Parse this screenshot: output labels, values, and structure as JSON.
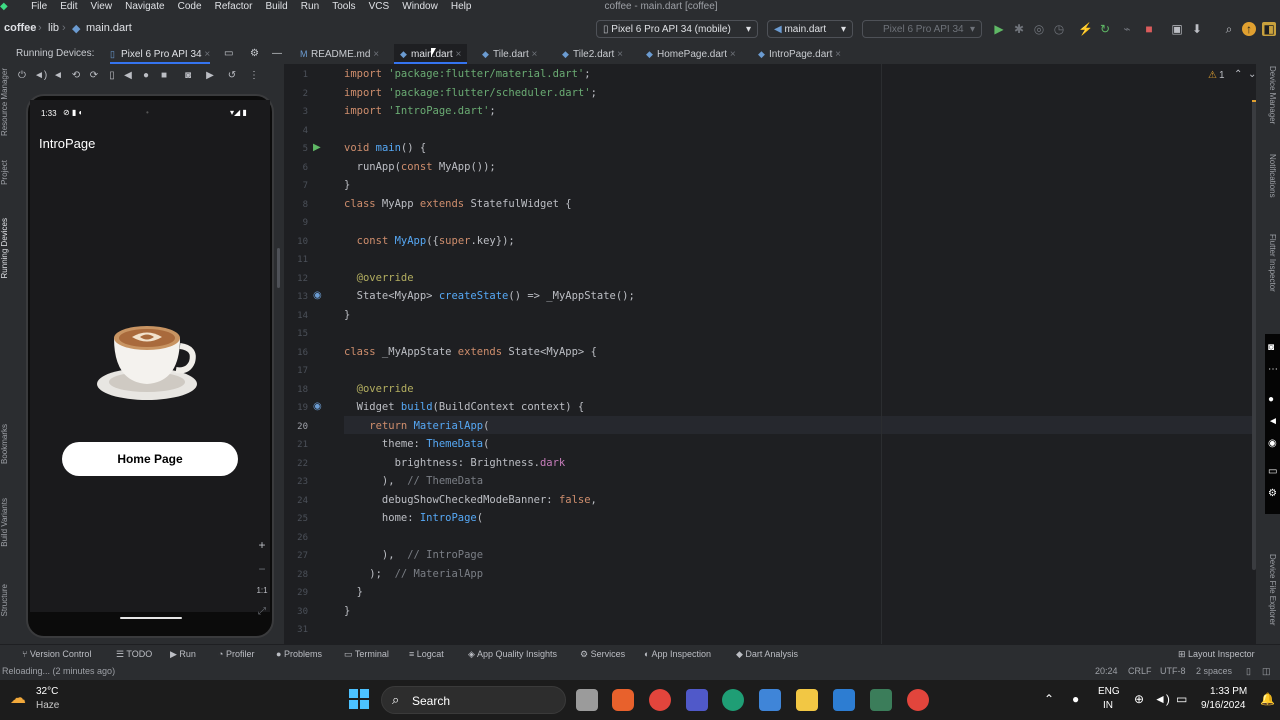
{
  "menu": [
    "File",
    "Edit",
    "View",
    "Navigate",
    "Code",
    "Refactor",
    "Build",
    "Run",
    "Tools",
    "VCS",
    "Window",
    "Help"
  ],
  "window_title": "coffee - main.dart [coffee]",
  "breadcrumb": {
    "project": "coffee",
    "folder": "lib",
    "file": "main.dart"
  },
  "device_selector": "Pixel 6 Pro API 34 (mobile)",
  "run_config": "main.dart",
  "device_selector_2": "Pixel 6 Pro API 34",
  "running_devices": {
    "label": "Running Devices:",
    "device_tab": "Pixel 6 Pro API 34"
  },
  "tabs": [
    {
      "label": "README.md",
      "active": false
    },
    {
      "label": "main.dart",
      "active": true
    },
    {
      "label": "Tile.dart",
      "active": false
    },
    {
      "label": "Tile2.dart",
      "active": false
    },
    {
      "label": "HomePage.dart",
      "active": false
    },
    {
      "label": "IntroPage.dart",
      "active": false
    }
  ],
  "inspection": {
    "warnings": "1"
  },
  "phone": {
    "time": "1:33",
    "app_title": "IntroPage",
    "home_button": "Home Page",
    "zoom_in": "+",
    "zoom_out": "−",
    "zoom_reset": "1:1"
  },
  "left_strip_labels": [
    "Resource Manager",
    "Project",
    "Running Devices",
    "Bookmarks",
    "Build Variants",
    "Structure"
  ],
  "right_strip_labels": [
    "Device Manager",
    "Notifications",
    "Flutter Inspector",
    "Device File Explorer"
  ],
  "code_lines": [
    {
      "n": "1",
      "t": [
        [
          "kw",
          "import"
        ],
        [
          "plain",
          " "
        ],
        [
          "str",
          "'package:flutter/material.dart'"
        ],
        [
          "plain",
          ";"
        ]
      ]
    },
    {
      "n": "2",
      "t": [
        [
          "kw",
          "import"
        ],
        [
          "plain",
          " "
        ],
        [
          "str",
          "'package:flutter/scheduler.dart'"
        ],
        [
          "plain",
          ";"
        ]
      ]
    },
    {
      "n": "3",
      "t": [
        [
          "kw",
          "import"
        ],
        [
          "plain",
          " "
        ],
        [
          "str",
          "'IntroPage.dart'"
        ],
        [
          "plain",
          ";"
        ]
      ]
    },
    {
      "n": "4",
      "t": []
    },
    {
      "n": "5",
      "t": [
        [
          "kw",
          "void"
        ],
        [
          "plain",
          " "
        ],
        [
          "fn",
          "main"
        ],
        [
          "plain",
          "() {"
        ]
      ]
    },
    {
      "n": "6",
      "t": [
        [
          "plain",
          "  runApp("
        ],
        [
          "kw",
          "const"
        ],
        [
          "plain",
          " MyApp());"
        ]
      ]
    },
    {
      "n": "7",
      "t": [
        [
          "plain",
          "}"
        ]
      ]
    },
    {
      "n": "8",
      "t": [
        [
          "kw",
          "class"
        ],
        [
          "plain",
          " MyApp "
        ],
        [
          "kw",
          "extends"
        ],
        [
          "plain",
          " StatefulWidget {"
        ]
      ]
    },
    {
      "n": "9",
      "t": []
    },
    {
      "n": "10",
      "t": [
        [
          "plain",
          "  "
        ],
        [
          "kw",
          "const"
        ],
        [
          "plain",
          " "
        ],
        [
          "fn",
          "MyApp"
        ],
        [
          "plain",
          "({"
        ],
        [
          "kw",
          "super"
        ],
        [
          "plain",
          ".key});"
        ]
      ]
    },
    {
      "n": "11",
      "t": []
    },
    {
      "n": "12",
      "t": [
        [
          "plain",
          "  "
        ],
        [
          "ann",
          "@override"
        ]
      ]
    },
    {
      "n": "13",
      "t": [
        [
          "plain",
          "  State<MyApp> "
        ],
        [
          "fn",
          "createState"
        ],
        [
          "plain",
          "() => _MyAppState();"
        ]
      ]
    },
    {
      "n": "14",
      "t": [
        [
          "plain",
          "}"
        ]
      ]
    },
    {
      "n": "15",
      "t": []
    },
    {
      "n": "16",
      "t": [
        [
          "kw",
          "class"
        ],
        [
          "plain",
          " _MyAppState "
        ],
        [
          "kw",
          "extends"
        ],
        [
          "plain",
          " State<MyApp> {"
        ]
      ]
    },
    {
      "n": "17",
      "t": []
    },
    {
      "n": "18",
      "t": [
        [
          "plain",
          "  "
        ],
        [
          "ann",
          "@override"
        ]
      ]
    },
    {
      "n": "19",
      "t": [
        [
          "plain",
          "  Widget "
        ],
        [
          "fn",
          "build"
        ],
        [
          "plain",
          "(BuildContext context) {"
        ]
      ]
    },
    {
      "n": "20",
      "t": [
        [
          "plain",
          "    "
        ],
        [
          "kw",
          "return"
        ],
        [
          "plain",
          " "
        ],
        [
          "fn",
          "MaterialApp"
        ],
        [
          "plain",
          "("
        ]
      ]
    },
    {
      "n": "21",
      "t": [
        [
          "plain",
          "      theme: "
        ],
        [
          "fn",
          "ThemeData"
        ],
        [
          "plain",
          "("
        ]
      ]
    },
    {
      "n": "22",
      "t": [
        [
          "plain",
          "        brightness: Brightness."
        ],
        [
          "cls",
          "dark"
        ]
      ]
    },
    {
      "n": "23",
      "t": [
        [
          "plain",
          "      ),  "
        ],
        [
          "cmt",
          "// ThemeData"
        ]
      ]
    },
    {
      "n": "24",
      "t": [
        [
          "plain",
          "      debugShowCheckedModeBanner: "
        ],
        [
          "kw",
          "false"
        ],
        [
          "plain",
          ","
        ]
      ]
    },
    {
      "n": "25",
      "t": [
        [
          "plain",
          "      home: "
        ],
        [
          "fn",
          "IntroPage"
        ],
        [
          "plain",
          "("
        ]
      ]
    },
    {
      "n": "26",
      "t": []
    },
    {
      "n": "27",
      "t": [
        [
          "plain",
          "      ),  "
        ],
        [
          "cmt",
          "// IntroPage"
        ]
      ]
    },
    {
      "n": "28",
      "t": [
        [
          "plain",
          "    );  "
        ],
        [
          "cmt",
          "// MaterialApp"
        ]
      ]
    },
    {
      "n": "29",
      "t": [
        [
          "plain",
          "  }"
        ]
      ]
    },
    {
      "n": "30",
      "t": [
        [
          "plain",
          "}"
        ]
      ]
    },
    {
      "n": "31",
      "t": []
    }
  ],
  "bottom_tools": [
    "Version Control",
    "TODO",
    "Run",
    "Profiler",
    "Problems",
    "Terminal",
    "Logcat",
    "App Quality Insights",
    "Services",
    "App Inspection",
    "Dart Analysis"
  ],
  "layout_inspector": "Layout Inspector",
  "status": {
    "message": "Reloading... (2 minutes ago)",
    "position": "20:24",
    "line_sep": "CRLF",
    "encoding": "UTF-8",
    "indent": "2 spaces"
  },
  "taskbar": {
    "weather_temp": "32°C",
    "weather_desc": "Haze",
    "search_label": "Search",
    "lang1": "ENG",
    "lang2": "IN",
    "time": "1:33 PM",
    "date": "9/16/2024"
  }
}
